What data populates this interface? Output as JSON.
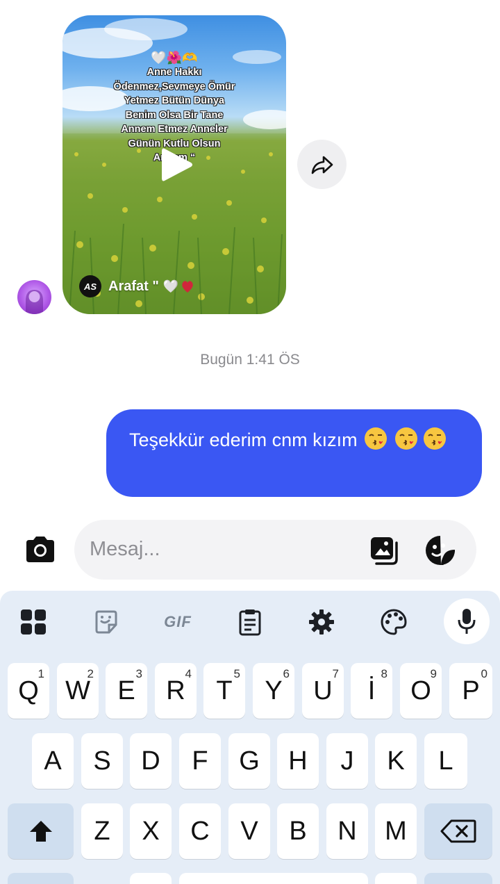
{
  "reel": {
    "emojis": "🤍🌺🫶",
    "lines": [
      "Anne Hakkı",
      "Ödenmez,Sevmeye Ömür",
      "Yetmez Bütün Dünya",
      "Benim Olsa Bir Tane",
      "Annem Etmez Anneler",
      "Günün Kutlu Olsun",
      "Annem “"
    ],
    "author_badge": "AS",
    "author_name": "Arafat \"",
    "author_emoji": "🤍"
  },
  "timestamp": "Bugün 1:41 ÖS",
  "outgoing_message": {
    "text": "Teşekkür ederim cnm kızım"
  },
  "composer": {
    "placeholder": "Mesaj..."
  },
  "keyboard": {
    "toolbar": {
      "gif_label": "GIF"
    },
    "row1": [
      {
        "label": "Q",
        "hint": "1"
      },
      {
        "label": "W",
        "hint": "2"
      },
      {
        "label": "E",
        "hint": "3"
      },
      {
        "label": "R",
        "hint": "4"
      },
      {
        "label": "T",
        "hint": "5"
      },
      {
        "label": "Y",
        "hint": "6"
      },
      {
        "label": "U",
        "hint": "7"
      },
      {
        "label": "İ",
        "hint": "8"
      },
      {
        "label": "O",
        "hint": "9"
      },
      {
        "label": "P",
        "hint": "0"
      }
    ],
    "row2": [
      "A",
      "S",
      "D",
      "F",
      "G",
      "H",
      "J",
      "K",
      "L"
    ],
    "row3": [
      "Z",
      "X",
      "C",
      "V",
      "B",
      "N",
      "M"
    ]
  },
  "colors": {
    "bubble": "#3a57f3",
    "keyboard_bg": "#e5edf7",
    "special_key": "#cfdeef"
  }
}
